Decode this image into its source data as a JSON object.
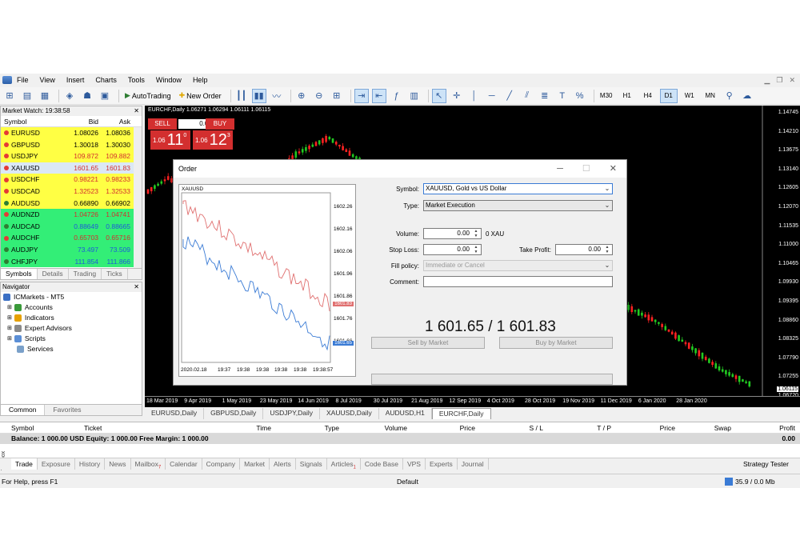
{
  "menu": {
    "items": [
      "File",
      "View",
      "Insert",
      "Charts",
      "Tools",
      "Window",
      "Help"
    ]
  },
  "toolbar": {
    "autotrading": "AutoTrading",
    "new_order": "New Order",
    "timeframes": [
      "M30",
      "H1",
      "H4",
      "D1",
      "W1",
      "MN"
    ],
    "active_timeframe": "D1"
  },
  "market_watch": {
    "title": "Market Watch: 19:38:58",
    "headers": {
      "symbol": "Symbol",
      "bid": "Bid",
      "ask": "Ask"
    },
    "rows": [
      {
        "symbol": "EURUSD",
        "bid": "1.08026",
        "ask": "1.08036",
        "bg": "#ffff44",
        "bid_color": "#000000",
        "dot": "#e53935"
      },
      {
        "symbol": "GBPUSD",
        "bid": "1.30018",
        "ask": "1.30030",
        "bg": "#ffff44",
        "bid_color": "#000000",
        "dot": "#e53935"
      },
      {
        "symbol": "USDJPY",
        "bid": "109.872",
        "ask": "109.882",
        "bg": "#ffff44",
        "bid_color": "#d32f2f",
        "dot": "#e53935"
      },
      {
        "symbol": "XAUUSD",
        "bid": "1601.65",
        "ask": "1601.83",
        "bg": "#dbe8f5",
        "bid_color": "#d32f2f",
        "dot": "#e53935"
      },
      {
        "symbol": "USDCHF",
        "bid": "0.98221",
        "ask": "0.98233",
        "bg": "#ffff44",
        "bid_color": "#d32f2f",
        "dot": "#e53935"
      },
      {
        "symbol": "USDCAD",
        "bid": "1.32523",
        "ask": "1.32533",
        "bg": "#ffff44",
        "bid_color": "#d32f2f",
        "dot": "#e53935"
      },
      {
        "symbol": "AUDUSD",
        "bid": "0.66890",
        "ask": "0.66902",
        "bg": "#ffff44",
        "bid_color": "#000000",
        "dot": "#2e7d32"
      },
      {
        "symbol": "AUDNZD",
        "bid": "1.04726",
        "ask": "1.04741",
        "bg": "#33ee77",
        "bid_color": "#d32f2f",
        "dot": "#e53935"
      },
      {
        "symbol": "AUDCAD",
        "bid": "0.88649",
        "ask": "0.88665",
        "bg": "#33ee77",
        "bid_color": "#1e5bd8",
        "dot": "#2e7d32"
      },
      {
        "symbol": "AUDCHF",
        "bid": "0.65703",
        "ask": "0.65716",
        "bg": "#33ee77",
        "bid_color": "#d32f2f",
        "dot": "#e53935"
      },
      {
        "symbol": "AUDJPY",
        "bid": "73.497",
        "ask": "73.509",
        "bg": "#33ee77",
        "bid_color": "#1e5bd8",
        "dot": "#2e7d32"
      },
      {
        "symbol": "CHFJPY",
        "bid": "111.854",
        "ask": "111.866",
        "bg": "#33ee77",
        "bid_color": "#1e5bd8",
        "dot": "#2e7d32"
      }
    ],
    "tabs": [
      "Symbols",
      "Details",
      "Trading",
      "Ticks"
    ]
  },
  "navigator": {
    "title": "Navigator",
    "root": "ICMarkets - MT5",
    "items": [
      "Accounts",
      "Indicators",
      "Expert Advisors",
      "Scripts",
      "Services"
    ],
    "tabs": [
      "Common",
      "Favorites"
    ]
  },
  "chart": {
    "title": "EURCHF,Daily  1.06271 1.06294 1.06111 1.06115",
    "sell_label": "SELL",
    "buy_label": "BUY",
    "lot": "0.01",
    "sell_price": {
      "small": "1.06",
      "big": "11",
      "sup": "0"
    },
    "buy_price": {
      "small": "1.06",
      "big": "12",
      "sup": "3"
    },
    "y_labels": [
      "1.14745",
      "1.14210",
      "1.13675",
      "1.13140",
      "1.12605",
      "1.12070",
      "1.11535",
      "1.11000",
      "1.10465",
      "1.09930",
      "1.09395",
      "1.08860",
      "1.08325",
      "1.07790",
      "1.07255",
      "1.06720",
      "1.06115"
    ],
    "x_labels": [
      "18 Mar 2019",
      "9 Apr 2019",
      "1 May 2019",
      "23 May 2019",
      "14 Jun 2019",
      "8 Jul 2019",
      "30 Jul 2019",
      "21 Aug 2019",
      "12 Sep 2019",
      "4 Oct 2019",
      "28 Oct 2019",
      "19 Nov 2019",
      "11 Dec 2019",
      "6 Jan 2020",
      "28 Jan 2020"
    ],
    "tabs": [
      "EURUSD,Daily",
      "GBPUSD,Daily",
      "USDJPY,Daily",
      "XAUUSD,Daily",
      "AUDUSD,H1",
      "EURCHF,Daily"
    ],
    "active_tab": "EURCHF,Daily"
  },
  "toolbox": {
    "headers": [
      "Symbol",
      "Ticket",
      "Time",
      "Type",
      "Volume",
      "Price",
      "S / L",
      "T / P",
      "Price",
      "Swap",
      "Profit"
    ],
    "balance": "Balance: 1 000.00 USD  Equity: 1 000.00  Free Margin: 1 000.00",
    "balance_profit": "0.00",
    "side_label": "Toolbox",
    "tabs": [
      "Trade",
      "Exposure",
      "History",
      "News",
      "Mailbox",
      "Calendar",
      "Company",
      "Market",
      "Alerts",
      "Signals",
      "Articles",
      "Code Base",
      "VPS",
      "Experts",
      "Journal"
    ],
    "mailbox_badge": "7",
    "articles_badge": "1",
    "strategy_tester": "Strategy Tester"
  },
  "status": {
    "help": "For Help, press F1",
    "profile": "Default",
    "net": "35.9 / 0.0 Mb"
  },
  "order": {
    "title": "Order",
    "minichart_symbol": "XAUUSD",
    "minichart_y": [
      "1602.26",
      "1602.16",
      "1602.06",
      "1601.96",
      "1601.86",
      "1601.76",
      "1601.66"
    ],
    "minichart_ask_tag": "1601.83",
    "minichart_bid_tag": "1601.65",
    "minichart_x": [
      "2020.02.18",
      "19:37",
      "19:38",
      "19:38",
      "19:38",
      "19:38",
      "19:38:57"
    ],
    "symbol_label": "Symbol:",
    "symbol_value": "XAUUSD, Gold vs US Dollar",
    "type_label": "Type:",
    "type_value": "Market Execution",
    "volume_label": "Volume:",
    "volume_value": "0.00",
    "volume_unit": "0 XAU",
    "sl_label": "Stop Loss:",
    "sl_value": "0.00",
    "tp_label": "Take Profit:",
    "tp_value": "0.00",
    "fill_label": "Fill policy:",
    "fill_value": "Immediate or Cancel",
    "comment_label": "Comment:",
    "comment_value": "",
    "quote": "1 601.65 / 1 601.83",
    "sell_button": "Sell by Market",
    "buy_button": "Buy by Market"
  }
}
